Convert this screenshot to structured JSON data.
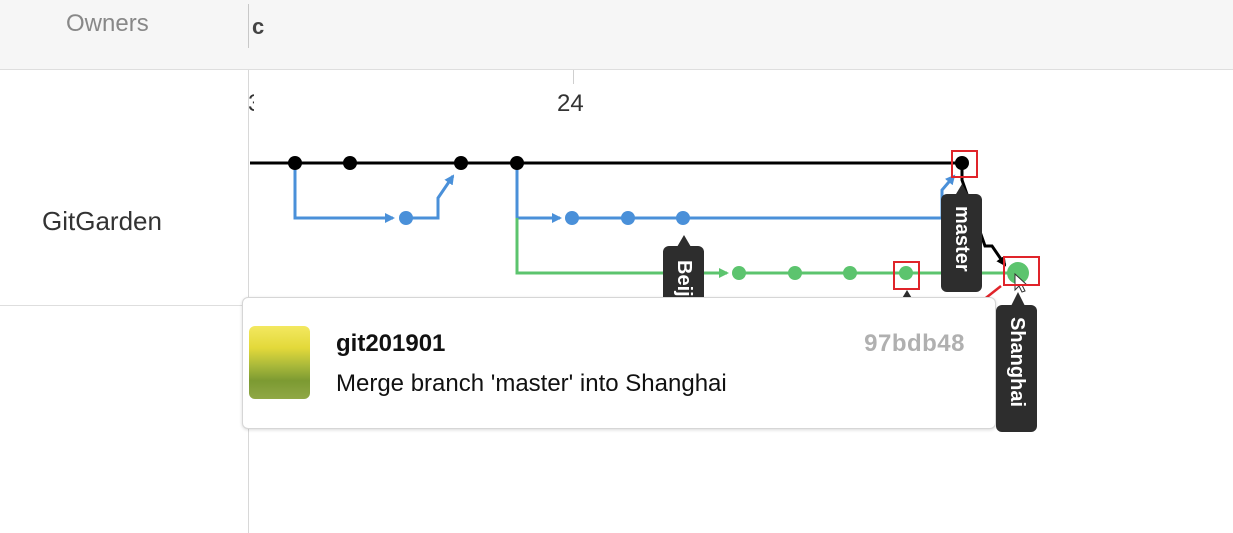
{
  "header": {
    "owners_label": "Owners",
    "month_label": "c"
  },
  "timeline": {
    "date_label": "24",
    "prev_date_label": "3"
  },
  "repository": {
    "name": "GitGarden"
  },
  "branches": {
    "master": {
      "label": "master",
      "color": "#000000"
    },
    "beijing": {
      "label": "Beijing",
      "color": "#4a90d9"
    },
    "shanghai": {
      "label": "Shanghai",
      "color": "#5cc46e"
    }
  },
  "commit_popup": {
    "user": "git201901",
    "message": "Merge branch 'master' into Shanghai",
    "hash": "97bdb48"
  },
  "colors": {
    "master_line": "#000000",
    "beijing_line": "#4a90d9",
    "shanghai_line": "#5cc46e",
    "highlight": "#e0242a",
    "tag_bg": "#2d2d2d"
  }
}
